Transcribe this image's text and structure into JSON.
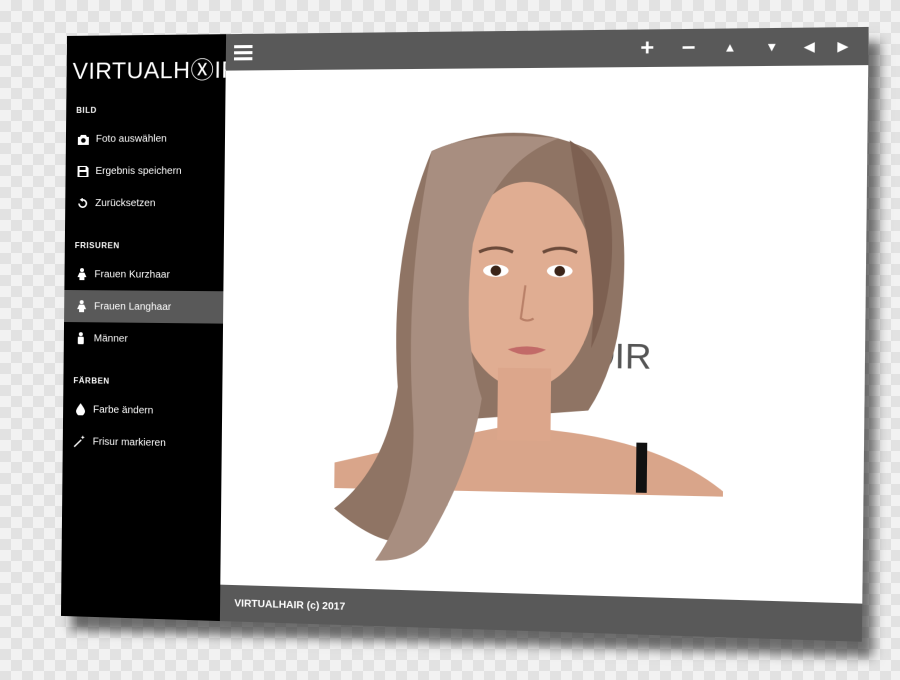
{
  "app": {
    "logo_text": "VIRTUALHⓍIR"
  },
  "sidebar": {
    "sections": [
      {
        "title": "BILD",
        "items": [
          {
            "label": "Foto auswählen",
            "icon": "camera-icon"
          },
          {
            "label": "Ergebnis speichern",
            "icon": "save-icon"
          },
          {
            "label": "Zurücksetzen",
            "icon": "undo-icon"
          }
        ]
      },
      {
        "title": "FRISUREN",
        "items": [
          {
            "label": "Frauen Kurzhaar",
            "icon": "female-icon"
          },
          {
            "label": "Frauen Langhaar",
            "icon": "female-icon",
            "active": true
          },
          {
            "label": "Männer",
            "icon": "male-icon"
          }
        ]
      },
      {
        "title": "FÄRBEN",
        "items": [
          {
            "label": "Farbe ändern",
            "icon": "drop-icon"
          },
          {
            "label": "Frisur markieren",
            "icon": "magic-wand-icon"
          }
        ]
      }
    ]
  },
  "toolbar": {
    "menu_icon": "hamburger-icon",
    "buttons": [
      {
        "symbol": "+",
        "icon": "zoom-in-icon"
      },
      {
        "symbol": "−",
        "icon": "zoom-out-icon"
      },
      {
        "symbol": "▲",
        "icon": "move-up-icon"
      },
      {
        "symbol": "▼",
        "icon": "move-down-icon"
      },
      {
        "symbol": "◀",
        "icon": "move-left-icon"
      },
      {
        "symbol": "▶",
        "icon": "move-right-icon"
      }
    ]
  },
  "canvas": {
    "watermark": "ⓍIR"
  },
  "footer": {
    "text": "VIRTUALHAIR (c) 2017"
  },
  "colors": {
    "sidebar_bg": "#000000",
    "bar_bg": "#595959",
    "active_item_bg": "#595959",
    "canvas_bg": "#ffffff"
  }
}
